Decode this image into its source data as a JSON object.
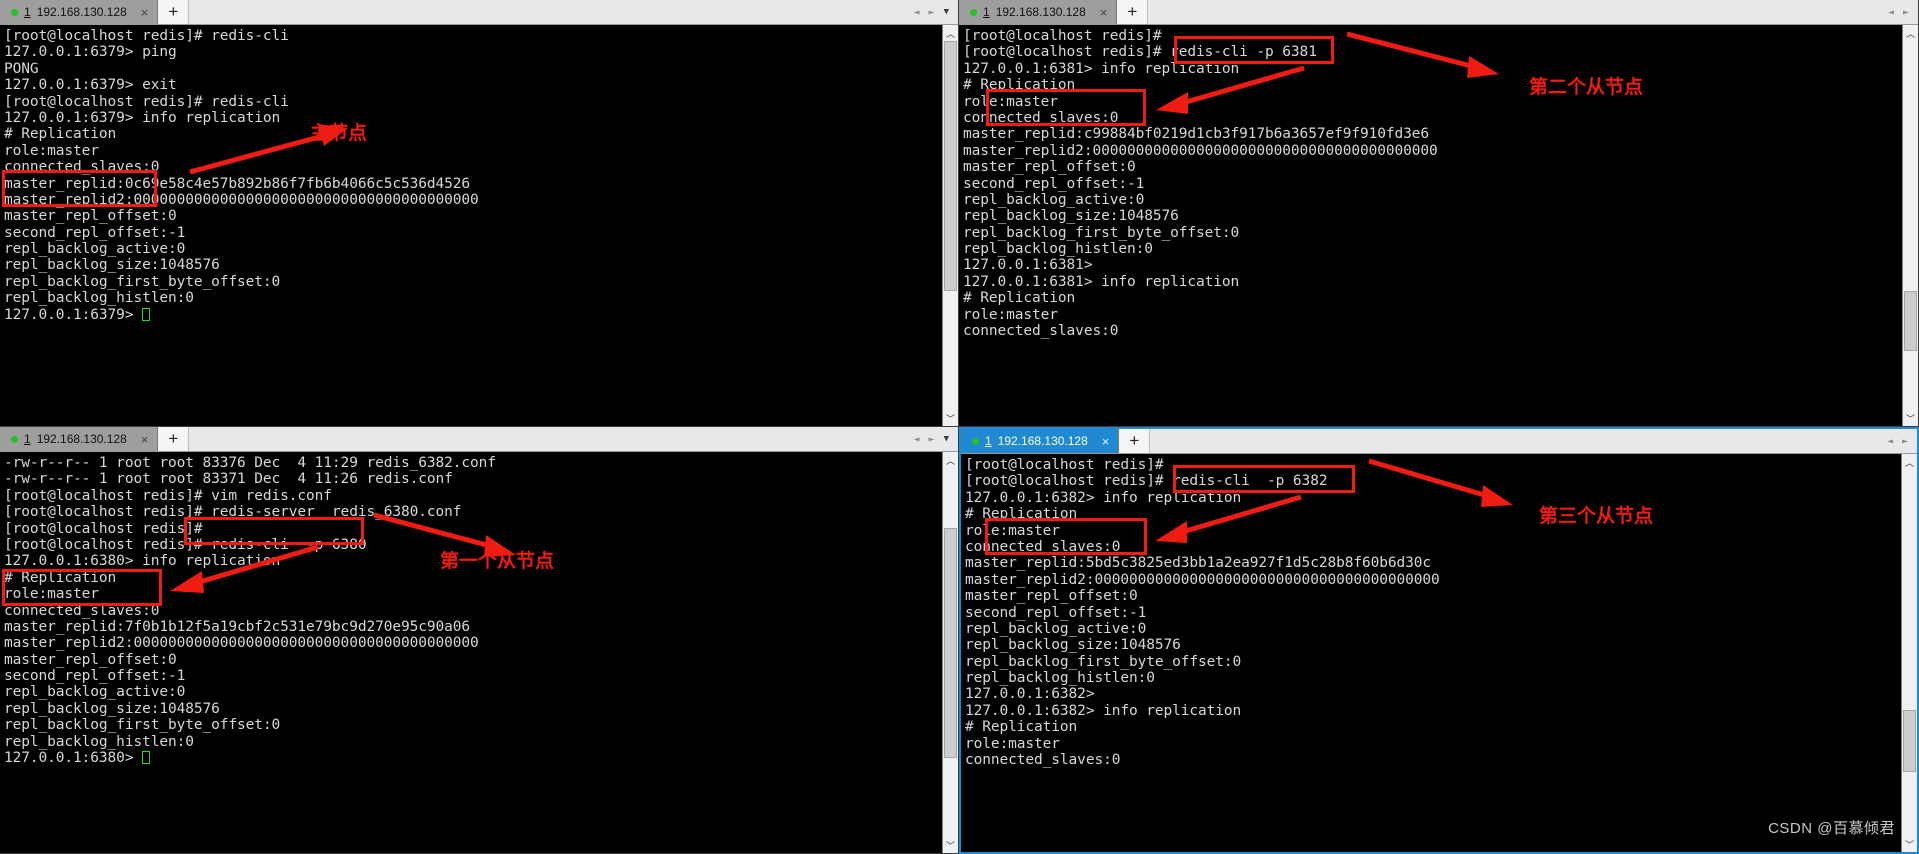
{
  "watermark": "CSDN @百慕倾君",
  "tab": {
    "index": "1",
    "title": "192.168.130.128",
    "close_label": "×",
    "new_tab_label": "+",
    "nav_prev": "◄",
    "nav_next": "►",
    "nav_caret": "▼"
  },
  "scrollbar": {
    "up": "︿",
    "down": "﹀"
  },
  "panels": [
    {
      "id": "top-left",
      "role": "master-node",
      "active": false,
      "annotation": "主节点",
      "lines": [
        "[root@localhost redis]# redis-cli",
        "127.0.0.1:6379> ping",
        "PONG",
        "127.0.0.1:6379> exit",
        "[root@localhost redis]# redis-cli",
        "127.0.0.1:6379> info replication",
        "# Replication",
        "role:master",
        "connected_slaves:0",
        "master_replid:0c69e58c4e57b892b86f7fb6b4066c5c536d4526",
        "master_replid2:0000000000000000000000000000000000000000",
        "master_repl_offset:0",
        "second_repl_offset:-1",
        "repl_backlog_active:0",
        "repl_backlog_size:1048576",
        "repl_backlog_first_byte_offset:0",
        "repl_backlog_histlen:0",
        "127.0.0.1:6379> "
      ],
      "cursor_line": 17
    },
    {
      "id": "top-right",
      "role": "second-slave-node",
      "active": false,
      "annotation": "第二个从节点",
      "command": "redis-cli -p 6381",
      "lines": [
        "[root@localhost redis]#",
        "[root@localhost redis]# redis-cli -p 6381",
        "127.0.0.1:6381> info replication",
        "# Replication",
        "role:master",
        "connected_slaves:0",
        "master_replid:c99884bf0219d1cb3f917b6a3657ef9f910fd3e6",
        "master_replid2:0000000000000000000000000000000000000000",
        "master_repl_offset:0",
        "second_repl_offset:-1",
        "repl_backlog_active:0",
        "repl_backlog_size:1048576",
        "repl_backlog_first_byte_offset:0",
        "repl_backlog_histlen:0",
        "127.0.0.1:6381>",
        "127.0.0.1:6381> info replication",
        "# Replication",
        "role:master",
        "connected_slaves:0"
      ],
      "cursor_line": -1
    },
    {
      "id": "bottom-left",
      "role": "first-slave-node",
      "active": false,
      "annotation": "第一个从节点",
      "command": "redis-cli  -p 6380",
      "lines": [
        "-rw-r--r-- 1 root root 83376 Dec  4 11:29 redis_6382.conf",
        "-rw-r--r-- 1 root root 83371 Dec  4 11:26 redis.conf",
        "[root@localhost redis]# vim redis.conf",
        "[root@localhost redis]# redis-server  redis_6380.conf",
        "[root@localhost redis]#",
        "[root@localhost redis]# redis-cli  -p 6380",
        "127.0.0.1:6380> info replication",
        "# Replication",
        "role:master",
        "connected_slaves:0",
        "master_replid:7f0b1b12f5a19cbf2c531e79bc9d270e95c90a06",
        "master_replid2:0000000000000000000000000000000000000000",
        "master_repl_offset:0",
        "second_repl_offset:-1",
        "repl_backlog_active:0",
        "repl_backlog_size:1048576",
        "repl_backlog_first_byte_offset:0",
        "repl_backlog_histlen:0",
        "127.0.0.1:6380> "
      ],
      "cursor_line": 18
    },
    {
      "id": "bottom-right",
      "role": "third-slave-node",
      "active": true,
      "annotation": "第三个从节点",
      "command": "redis-cli  -p 6382",
      "lines": [
        "[root@localhost redis]#",
        "[root@localhost redis]# redis-cli  -p 6382",
        "127.0.0.1:6382> info replication",
        "# Replication",
        "role:master",
        "connected_slaves:0",
        "master_replid:5bd5c3825ed3bb1a2ea927f1d5c28b8f60b6d30c",
        "master_replid2:0000000000000000000000000000000000000000",
        "master_repl_offset:0",
        "second_repl_offset:-1",
        "repl_backlog_active:0",
        "repl_backlog_size:1048576",
        "repl_backlog_first_byte_offset:0",
        "repl_backlog_histlen:0",
        "127.0.0.1:6382>",
        "127.0.0.1:6382> info replication",
        "# Replication",
        "role:master",
        "connected_slaves:0"
      ],
      "cursor_line": -1
    }
  ]
}
